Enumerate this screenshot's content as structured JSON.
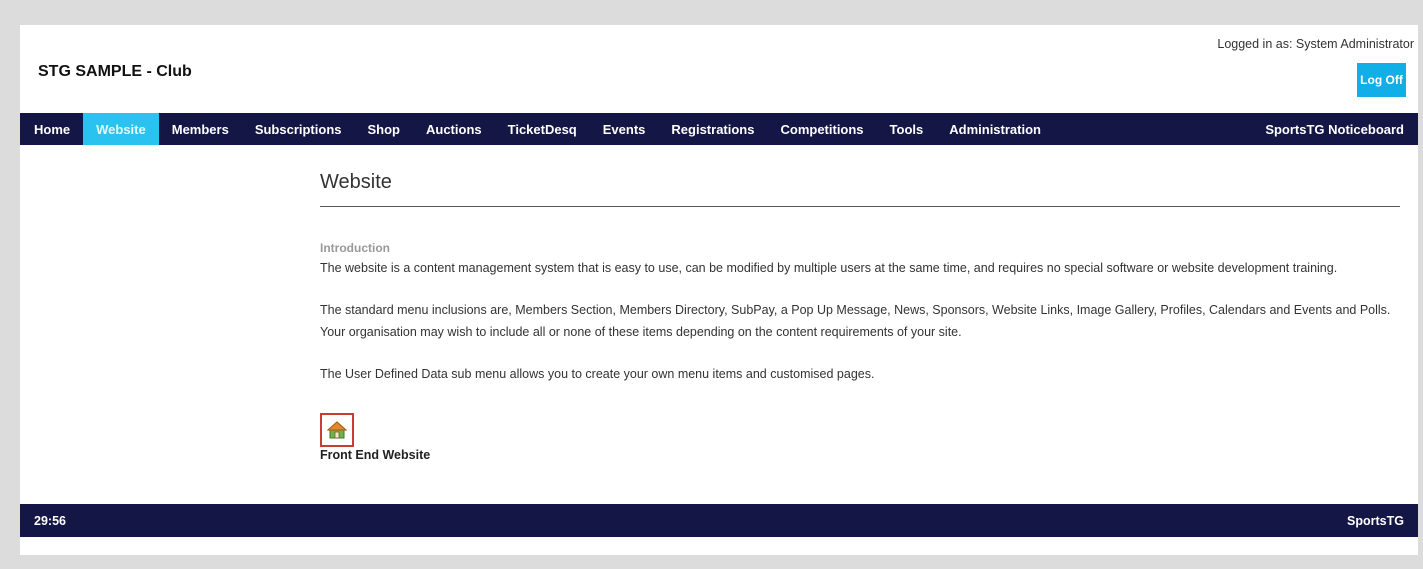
{
  "header": {
    "site_title": "STG SAMPLE - Club",
    "logged_in_text": "Logged in as: System Administrator",
    "logoff_label": "Log Off"
  },
  "nav": {
    "items": [
      {
        "label": "Home"
      },
      {
        "label": "Website"
      },
      {
        "label": "Members"
      },
      {
        "label": "Subscriptions"
      },
      {
        "label": "Shop"
      },
      {
        "label": "Auctions"
      },
      {
        "label": "TicketDesq"
      },
      {
        "label": "Events"
      },
      {
        "label": "Registrations"
      },
      {
        "label": "Competitions"
      },
      {
        "label": "Tools"
      },
      {
        "label": "Administration"
      }
    ],
    "active_index": 1,
    "right_label": "SportsTG Noticeboard",
    "bar_color": "#141645",
    "active_color": "#2ac3f0"
  },
  "content": {
    "title": "Website",
    "section_label": "Introduction",
    "paragraphs": [
      "The website is a content management system that is easy to use, can be modified by multiple users at the same time, and requires no special software or website development training.",
      "The standard menu inclusions are, Members Section, Members Directory, SubPay, a Pop Up Message, News, Sponsors, Website Links, Image Gallery, Profiles, Calendars and Events and Polls. Your organisation may wish to include all or none of these items depending on the content requirements of your site.",
      "The User Defined Data sub menu allows you to create your own menu items and customised pages."
    ],
    "front_end_icon": "house-icon",
    "front_end_label": "Front End Website"
  },
  "footer": {
    "timer": "29:56",
    "brand": "SportsTG"
  }
}
